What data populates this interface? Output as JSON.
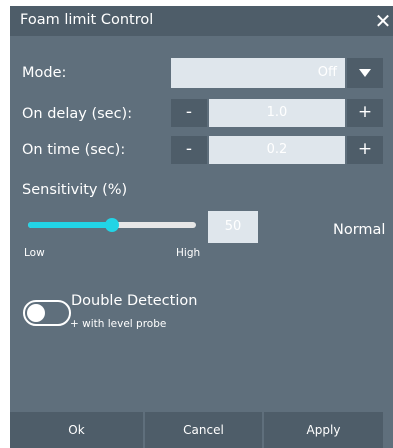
{
  "dialog": {
    "title": "Foam limit Control",
    "close_glyph": "✕"
  },
  "mode": {
    "label": "Mode:",
    "value": "Off",
    "dropdown_icon": "triangle-down-icon"
  },
  "on_delay": {
    "label": "On delay (sec):",
    "value": "1.0",
    "minus": "-",
    "plus": "+"
  },
  "on_time": {
    "label": "On time (sec):",
    "value": "0.2",
    "minus": "-",
    "plus": "+"
  },
  "sensitivity": {
    "label": "Sensitivity (%)",
    "value": "50",
    "level_fraction": 0.5,
    "low_label": "Low",
    "high_label": "High",
    "status": "Normal"
  },
  "double_detection": {
    "title": "Double Detection",
    "subtitle": "+ with level probe",
    "enabled": false
  },
  "buttons": {
    "ok": "Ok",
    "cancel": "Cancel",
    "apply": "Apply"
  },
  "colors": {
    "panel": "#5f6f7c",
    "dark": "#4e5d69",
    "field": "#dfe6ec",
    "accent": "#22d4e6"
  }
}
